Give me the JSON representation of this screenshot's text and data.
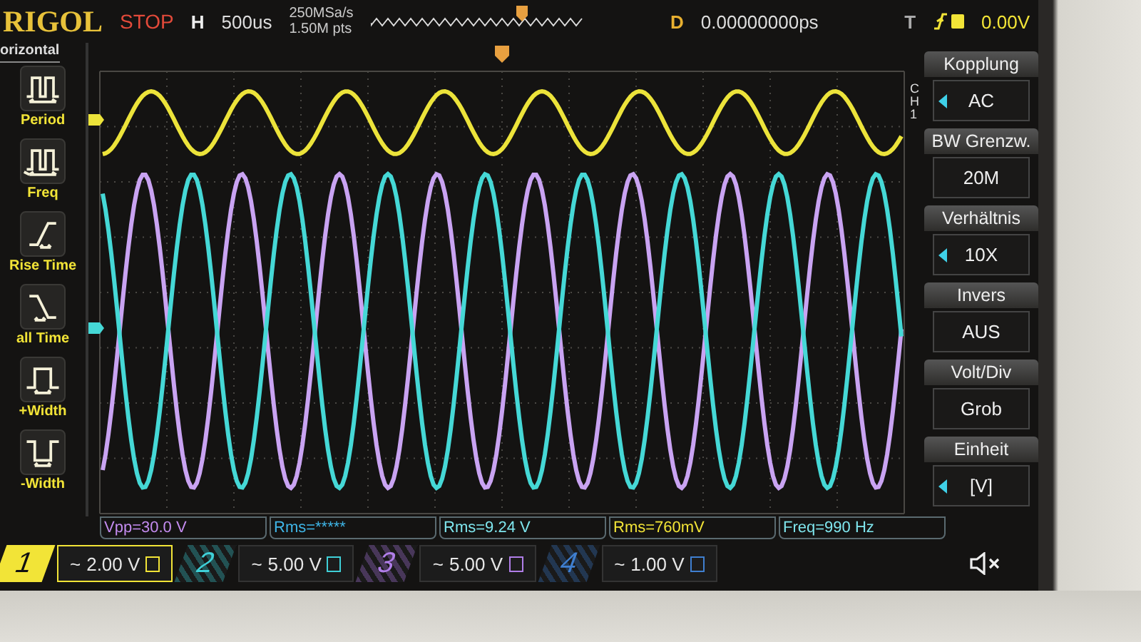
{
  "header": {
    "logo": "RIGOL",
    "run_state": "STOP",
    "timebase_label": "H",
    "timebase": "500us",
    "sample_rate": "250MSa/s",
    "memory_depth": "1.50M pts",
    "delay_label": "D",
    "delay": "0.00000000ps",
    "trigger_label": "T",
    "trigger_level": "0.00V"
  },
  "left_menu": {
    "title": "orizontal",
    "items": [
      {
        "kind": "period",
        "label": "Period"
      },
      {
        "kind": "freq",
        "label": "Freq"
      },
      {
        "kind": "rise",
        "label": "Rise Time"
      },
      {
        "kind": "fall",
        "label": "all Time"
      },
      {
        "kind": "pwidth",
        "label": "+Width"
      },
      {
        "kind": "nwidth",
        "label": "-Width"
      }
    ]
  },
  "right_menu": {
    "channel_label": "CH1",
    "items": [
      {
        "title": "Kopplung",
        "value": "AC",
        "adjustable": true
      },
      {
        "title": "BW Grenzw.",
        "value": "20M",
        "adjustable": false
      },
      {
        "title": "Verhältnis",
        "value": "10X",
        "adjustable": true
      },
      {
        "title": "Invers",
        "value": "AUS",
        "adjustable": false
      },
      {
        "title": "Volt/Div",
        "value": "Grob",
        "adjustable": false
      },
      {
        "title": "Einheit",
        "value": "[V]",
        "adjustable": true
      }
    ]
  },
  "measurements": [
    {
      "text": "Vpp=30.0 V",
      "color": "#c48cf0"
    },
    {
      "text": "Rms=*****",
      "color": "#3fb6e8"
    },
    {
      "text": "Rms=9.24 V",
      "color": "#7fe6ee"
    },
    {
      "text": "Rms=760mV",
      "color": "#f2e437"
    },
    {
      "text": "Freq=990 Hz",
      "color": "#7fe6ee"
    }
  ],
  "channels": [
    {
      "number": "1",
      "coupling": "~",
      "scale": "2.00 V",
      "color": "#f2e437",
      "selected": true
    },
    {
      "number": "2",
      "coupling": "~",
      "scale": "5.00 V",
      "color": "#3fd0d8",
      "selected": false
    },
    {
      "number": "3",
      "coupling": "~",
      "scale": "5.00 V",
      "color": "#b07ee8",
      "selected": false
    },
    {
      "number": "4",
      "coupling": "~",
      "scale": "1.00 V",
      "color": "#3f7fd0",
      "selected": false
    }
  ]
}
